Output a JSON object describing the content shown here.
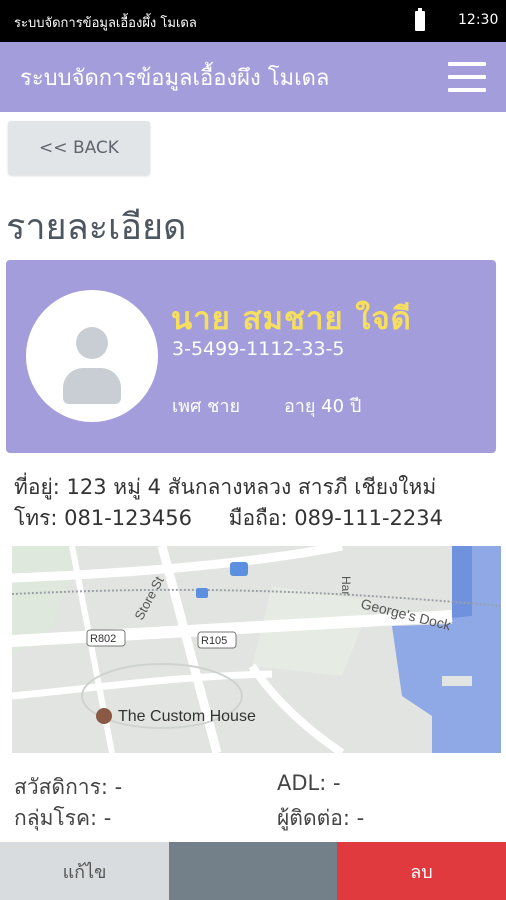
{
  "status_bar": {
    "title": "ระบบจัดการข้อมูลเอื้องผึ้ง โมเดล",
    "time": "12:30"
  },
  "app_bar": {
    "title": "ระบบจัดการข้อมูลเอื้องผึง โมเดล"
  },
  "back_button": {
    "label": "<< BACK"
  },
  "page": {
    "heading": "รายละเอียด"
  },
  "profile": {
    "name": "นาย สมชาย ใจดี",
    "id_number": "3-5499-1112-33-5",
    "gender": "เพศ ชาย",
    "age": "อายุ  40 ปี"
  },
  "contact": {
    "address": "ที่อยู่: 123 หมู่ 4 สันกลางหลวง สารภี เชียงใหม่",
    "phone": "โทร: 081-123456",
    "mobile": "มือถือ: 089-111-2234"
  },
  "map": {
    "labels": {
      "store_st": "Store St",
      "r802": "R802",
      "r105": "R105",
      "georges_dock": "George's Dock",
      "custom_house": "The Custom House",
      "harbour": "Har"
    }
  },
  "details": {
    "welfare": "สวัสดิการ: -",
    "adl": "ADL: -",
    "disease_group": "กลุ่มโรค: -",
    "contact_person": "ผู้ติดต่อ: -"
  },
  "actions": {
    "edit": "แก้ไข",
    "delete": "ลบ"
  },
  "colors": {
    "header": "#a49ddb",
    "name_text": "#f6df5e",
    "delete": "#e0393e",
    "middle": "#738089",
    "edit": "#d8dcdf"
  }
}
